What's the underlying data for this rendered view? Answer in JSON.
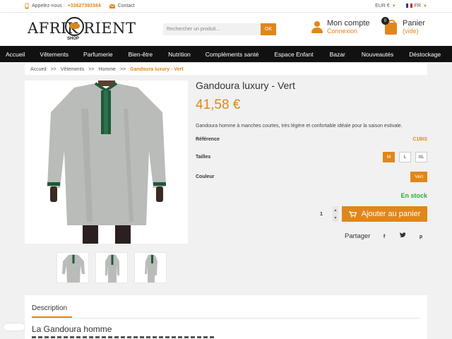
{
  "topbar": {
    "phone_label": "Appelez-nous :",
    "phone_number": "+33627393384",
    "contact_label": "Contact",
    "currency": "EUR €",
    "language": "FR"
  },
  "logo": {
    "text": "AFRIK  RIENT",
    "subtext": "SHOP"
  },
  "search": {
    "placeholder": "Rechercher un produit...",
    "button": "OK"
  },
  "account": {
    "title": "Mon compte",
    "subtitle": "Connexion"
  },
  "cart": {
    "title": "Panier",
    "subtitle": "(vide)",
    "count": "0"
  },
  "nav": {
    "items": [
      "Accueil",
      "Vêtements",
      "Parfumerie",
      "Bien-être",
      "Nutrition",
      "Compléments santé",
      "Espace Enfant",
      "Bazar",
      "Nouveautés",
      "Déstockage"
    ]
  },
  "breadcrumb": {
    "items": [
      "Accueil",
      "Vêtements",
      "Homme"
    ],
    "separator": ">>",
    "current": "Gandoura luxury - Vert"
  },
  "product": {
    "title": "Gandoura luxury - Vert",
    "price": "41,58 €",
    "short_description": "Gandoura homme à manches courtes, très légère et confortable idéale pour la saison estivale.",
    "reference_label": "Référence",
    "reference_value": "C1BIS",
    "sizes_label": "Tailles",
    "sizes": [
      "M",
      "L",
      "XL"
    ],
    "selected_size": "M",
    "color_label": "Couleur",
    "color_value": "Vert",
    "stock": "En stock",
    "quantity": "1",
    "add_to_cart": "Ajouter au panier",
    "share_label": "Partager",
    "share_icons": [
      "facebook-icon",
      "twitter-icon",
      "pinterest-icon"
    ]
  },
  "description": {
    "tab_label": "Description",
    "heading": "La Gandoura homme"
  },
  "colors": {
    "accent": "#e0871b",
    "stock_green": "#2bae35",
    "nav_bg": "#111111",
    "garment": "#b9bcb9",
    "embroidery": "#1e5a38"
  }
}
